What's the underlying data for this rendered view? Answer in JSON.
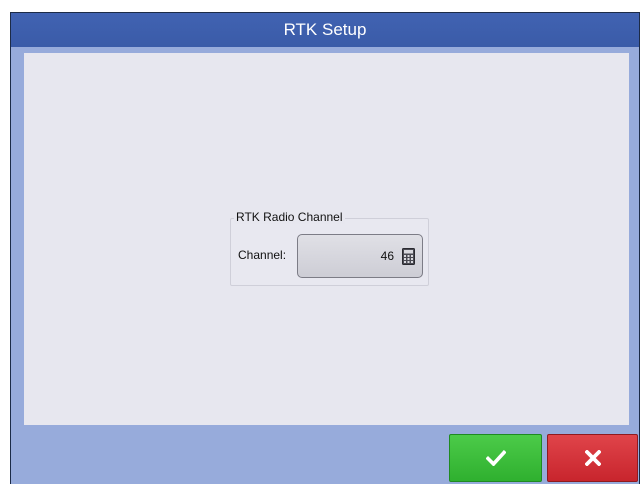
{
  "window": {
    "title": "RTK Setup"
  },
  "group": {
    "legend": "RTK Radio Channel",
    "channel_label": "Channel:",
    "channel_value": "46",
    "value_icon": "calculator-icon"
  },
  "buttons": {
    "ok_icon": "checkmark-icon",
    "cancel_icon": "close-icon"
  },
  "colors": {
    "titlebar": "#3d5fad",
    "background": "#97abdb",
    "content": "#e7e7ef",
    "ok": "#38b838",
    "cancel": "#d2313a"
  }
}
